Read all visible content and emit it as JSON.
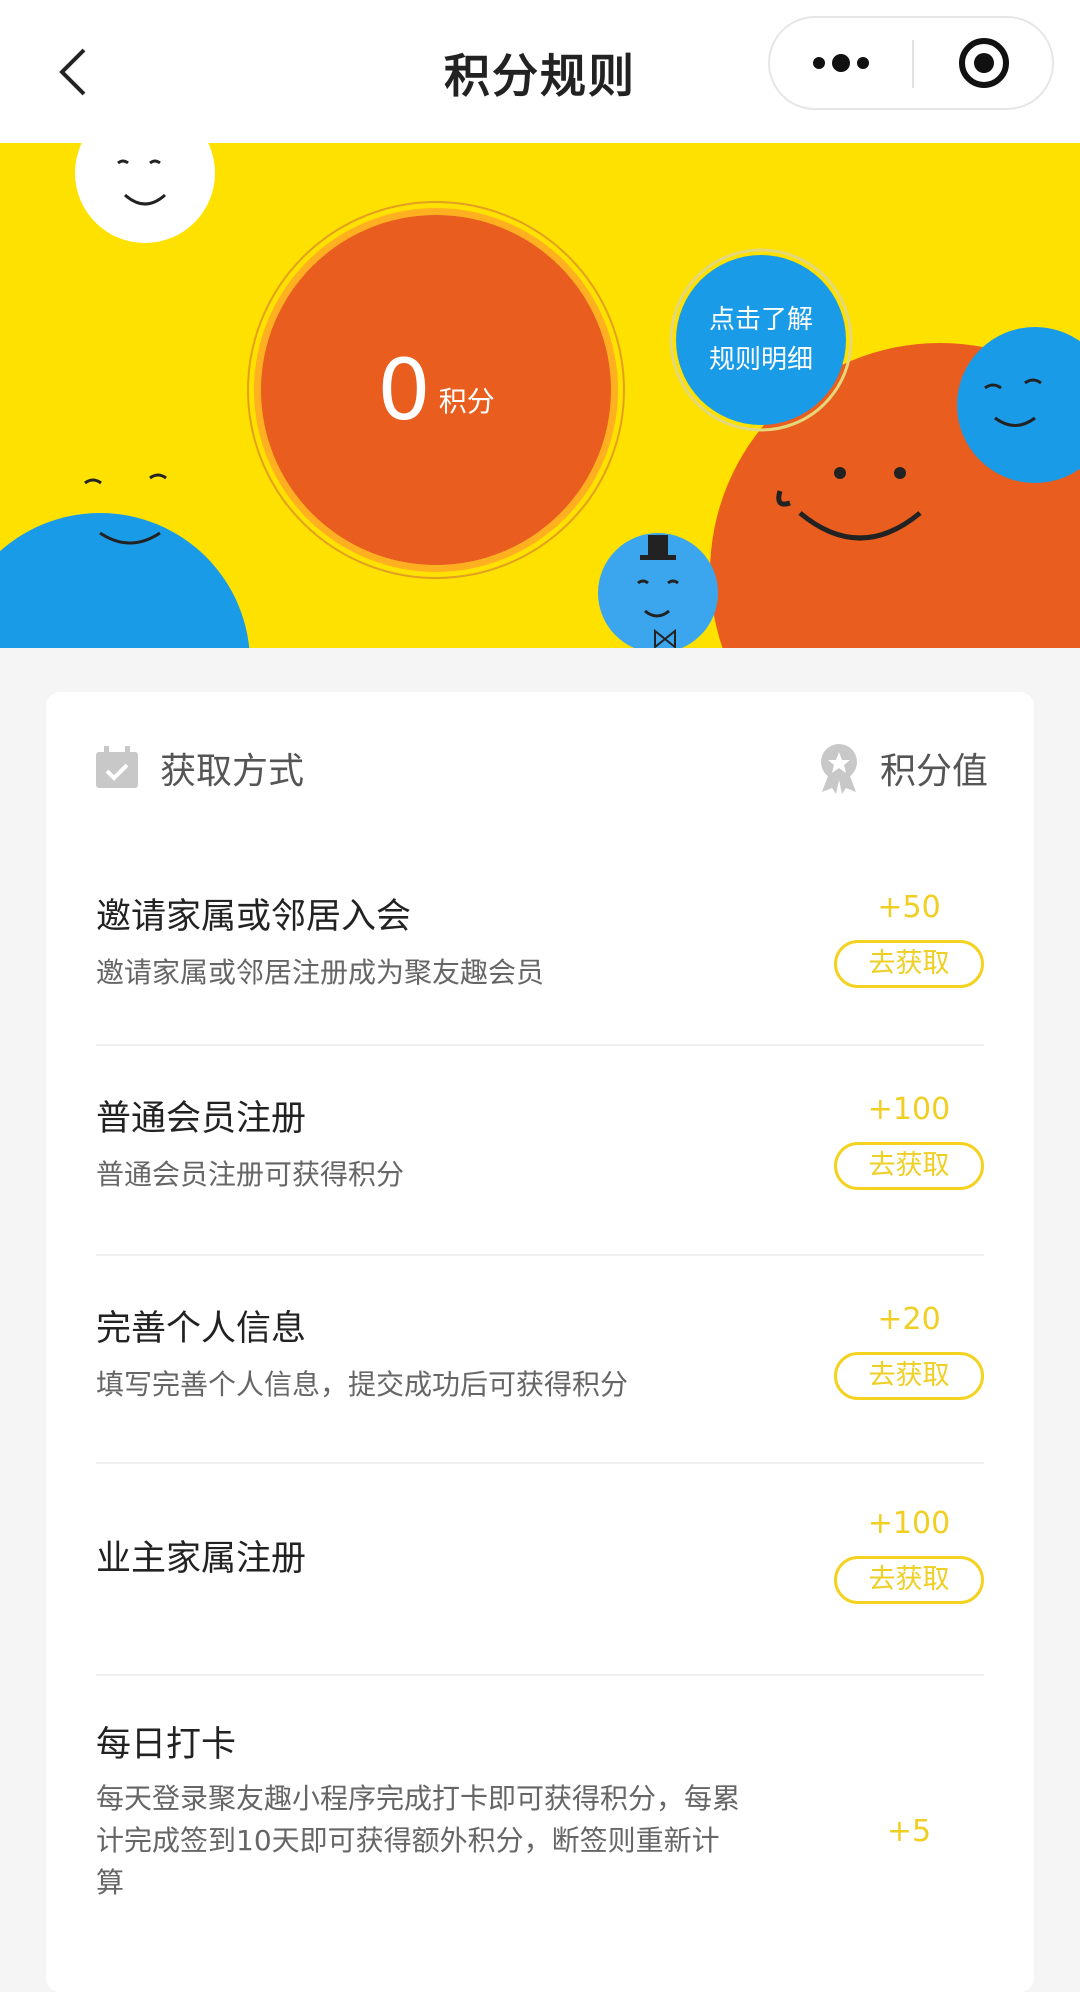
{
  "navbar": {
    "title": "积分规则",
    "back_icon": "chevron-left-icon",
    "more_icon": "more-dots-icon",
    "close_icon": "target-close-icon"
  },
  "banner": {
    "points_value": "0",
    "points_unit": "积分",
    "rules_line1": "点击了解",
    "rules_line2": "规则明细",
    "colors": {
      "yellow": "#ffe100",
      "orange": "#e95d1e",
      "blue": "#1a9be8"
    }
  },
  "card": {
    "method_header": "获取方式",
    "value_header": "积分值",
    "items": [
      {
        "title": "邀请家属或邻居入会",
        "desc": "邀请家属或邻居注册成为聚友趣会员",
        "points": "+50",
        "button": "去获取"
      },
      {
        "title": "普通会员注册",
        "desc": "普通会员注册可获得积分",
        "points": "+100",
        "button": "去获取"
      },
      {
        "title": "完善个人信息",
        "desc": "填写完善个人信息，提交成功后可获得积分",
        "points": "+20",
        "button": "去获取"
      },
      {
        "title": "业主家属注册",
        "desc": "",
        "points": "+100",
        "button": "去获取"
      },
      {
        "title": "每日打卡",
        "desc": "每天登录聚友趣小程序完成打卡即可获得积分，每累计完成签到10天即可获得额外积分，断签则重新计算",
        "points": "+5",
        "button": ""
      }
    ],
    "accent_color": "#f1cf22"
  }
}
